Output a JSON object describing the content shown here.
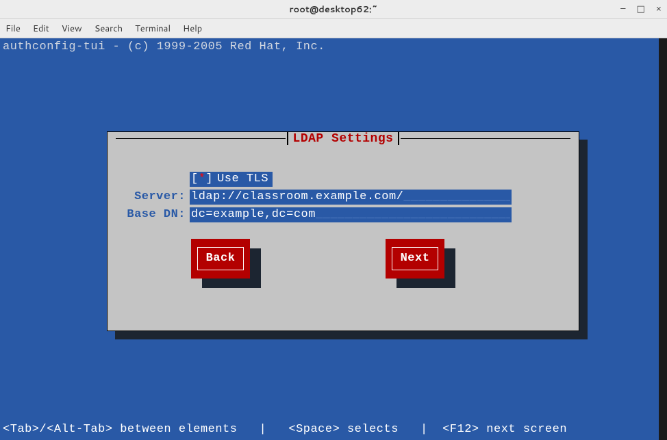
{
  "window": {
    "title": "root@desktop62:~",
    "controls": {
      "minimize": "–",
      "maximize": "□",
      "close": "×"
    }
  },
  "menu": {
    "file": "File",
    "edit": "Edit",
    "view": "View",
    "search": "Search",
    "terminal": "Terminal",
    "help": "Help"
  },
  "header_line": "authconfig-tui - (c) 1999-2005 Red Hat, Inc.",
  "dialog": {
    "title": "LDAP Settings",
    "use_tls": {
      "state": "*",
      "bracket_open": "[",
      "bracket_close": "]",
      "label": "Use TLS"
    },
    "server": {
      "label": "Server:",
      "value": "ldap://classroom.example.com/"
    },
    "base_dn": {
      "label": "Base DN:",
      "value": "dc=example,dc=com"
    },
    "buttons": {
      "back": "Back",
      "next": "Next"
    }
  },
  "status": "<Tab>/<Alt-Tab> between elements   |   <Space> selects   |  <F12> next screen"
}
